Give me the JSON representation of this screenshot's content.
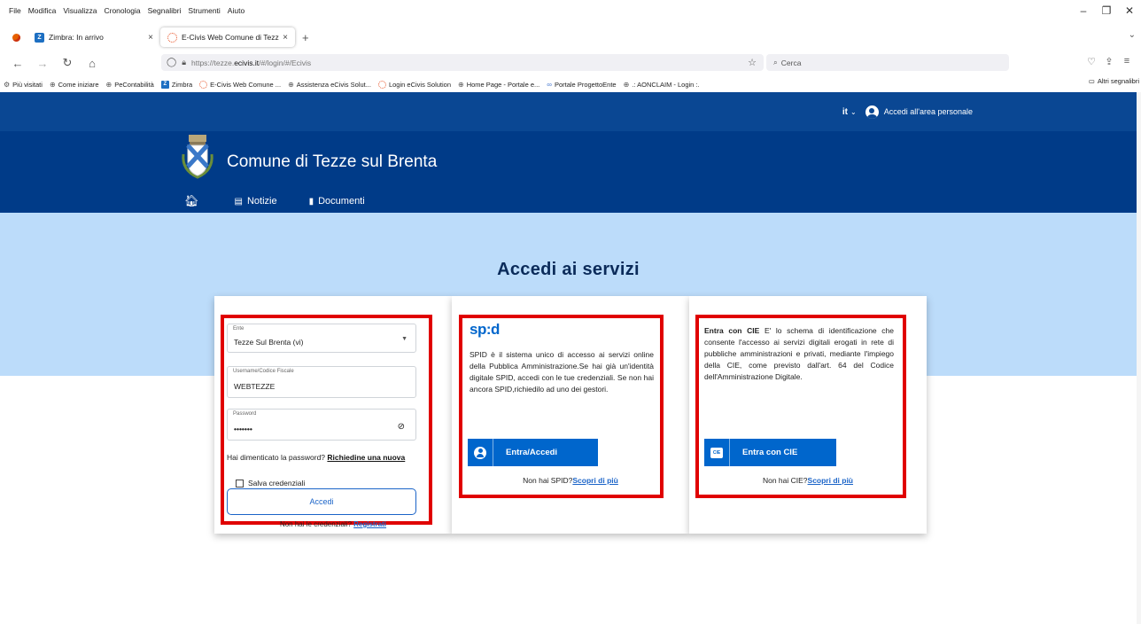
{
  "browser": {
    "menu": [
      "File",
      "Modifica",
      "Visualizza",
      "Cronologia",
      "Segnalibri",
      "Strumenti",
      "Aiuto"
    ],
    "tabs": [
      {
        "label": "Zimbra: In arrivo",
        "icon": "zimbra-icon",
        "close": "×"
      },
      {
        "label": "E-Civis Web Comune di Tezze s",
        "icon": "ecivis-icon",
        "close": "×"
      }
    ],
    "new_tab": "+",
    "url_prefix": "https://tezze.",
    "url_domain": "ecivis.it",
    "url_suffix": "/#/login/#/Ecivis",
    "search_placeholder": "Cerca",
    "bookmarks": [
      {
        "label": "Più visitati",
        "icon": "gear-icon"
      },
      {
        "label": "Come iniziare",
        "icon": "globe-icon"
      },
      {
        "label": "PeContabilità",
        "icon": "globe-icon"
      },
      {
        "label": "Zimbra",
        "icon": "zimbra-icon"
      },
      {
        "label": "E-Civis Web Comune ...",
        "icon": "ecivis-icon"
      },
      {
        "label": "Assistenza eCivis Solut...",
        "icon": "globe-icon"
      },
      {
        "label": "Login eCivis Solution",
        "icon": "ecivis-icon"
      },
      {
        "label": "Home Page - Portale e...",
        "icon": "globe-icon"
      },
      {
        "label": "Portale ProgettoEnte",
        "icon": "pe-icon"
      },
      {
        "label": ".: AONCLAIM - Login :.",
        "icon": "globe-icon"
      }
    ],
    "other_bookmarks": "Altri segnalibri"
  },
  "site": {
    "lang": "it",
    "personal_area": "Accedi all'area personale",
    "comune": "Comune di Tezze sul Brenta",
    "nav": {
      "news": "Notizie",
      "docs": "Documenti"
    },
    "title": "Accedi ai servizi",
    "colors": {
      "topstrip": "#0a4793",
      "header": "#003b88",
      "hero": "#bcdcfa",
      "accent": "#0066cc",
      "highlight": "#e00000"
    }
  },
  "login": {
    "ente_label": "Ente",
    "ente_value": "Tezze Sul Brenta (vi)",
    "user_label": "Username/Codice Fiscale",
    "user_value": "WEBTEZZE",
    "pwd_label": "Password",
    "pwd_value": "•••••••",
    "forgot_text": "Hai dimenticato la password?",
    "forgot_link": "Richiedine una nuova",
    "remember": "Salva credenziali",
    "submit": "Accedi",
    "no_cred_text": "Non hai le credenziali?",
    "no_cred_link": "Registrati"
  },
  "spid": {
    "logo": "sp:d",
    "text": "SPID è il sistema unico di accesso ai servizi online della Pubblica Amministrazione.Se hai già un'identità digitale SPID, accedi con le tue credenziali. Se non hai ancora SPID,richiedilo ad uno dei gestori.",
    "button": "Entra/Accedi",
    "no_text": "Non hai SPID?",
    "no_link": "Scopri di più"
  },
  "cie": {
    "bold": "Entra con CIE",
    "text": " E' lo schema di identificazione che consente l'accesso ai servizi digitali erogati in rete di pubbliche amministrazioni e privati, mediante l'impiego della CIE, come previsto dall'art. 64 del Codice dell'Amministrazione Digitale.",
    "button": "Entra con CIE",
    "no_text": "Non hai CIE?",
    "no_link": "Scopri di più"
  }
}
